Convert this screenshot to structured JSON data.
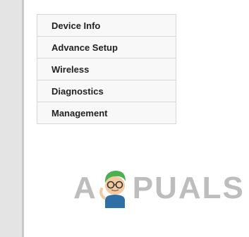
{
  "nav_menu": {
    "items": [
      {
        "label": "Device Info"
      },
      {
        "label": "Advance Setup"
      },
      {
        "label": "Wireless"
      },
      {
        "label": "Diagnostics"
      },
      {
        "label": "Management"
      }
    ]
  },
  "watermark": {
    "text_left": "A",
    "text_right": "PUALS",
    "icon": "mascot-icon"
  }
}
